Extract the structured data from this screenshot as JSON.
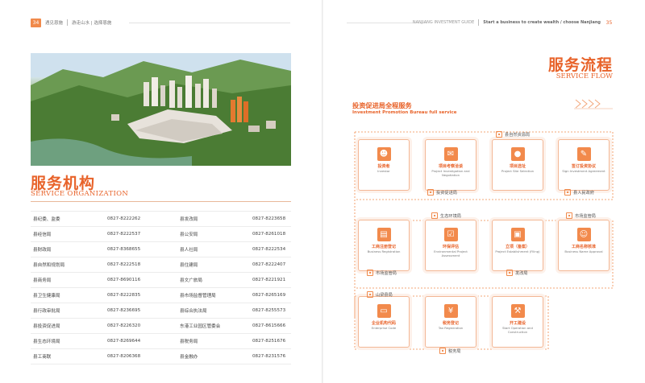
{
  "left_page": {
    "page_number": "34",
    "header_title": "遇见恩施",
    "header_subtitle": "游走山水 | 选择恩施",
    "title_cn": "服务机构",
    "title_en": "SERVICE ORGANIZATION",
    "directory": [
      [
        "县纪委、监委",
        "0827-8222262",
        "县发改局",
        "0827-8223658"
      ],
      [
        "县经信局",
        "0827-8222537",
        "县公安局",
        "0827-8261018"
      ],
      [
        "县财政局",
        "0827-8368655",
        "县人社局",
        "0827-8222534"
      ],
      [
        "县自然和规划局",
        "0827-8222518",
        "县住建局",
        "0827-8222407"
      ],
      [
        "县商务局",
        "0827-8690116",
        "县文广旅局",
        "0827-8221921"
      ],
      [
        "县卫生健康局",
        "0827-8222835",
        "县市场监督管理局",
        "0827-8265169"
      ],
      [
        "县行政审批局",
        "0827-8236695",
        "县综合执法局",
        "0827-8255573"
      ],
      [
        "县投资促进局",
        "0827-8226320",
        "东港工业园区管委会",
        "0827-8615666"
      ],
      [
        "县生态环境局",
        "0827-8269644",
        "县税务局",
        "0827-8251676"
      ],
      [
        "县工商联",
        "0827-8206368",
        "县金融办",
        "0827-8231576"
      ]
    ]
  },
  "right_page": {
    "page_number": "35",
    "header_en": "NANJIANG INVESTMENT GUIDE",
    "header_slogan": "Start a business to create wealth / choose Nanjiang",
    "title_cn": "服务流程",
    "title_en": "SERVICE FLOW",
    "subtitle_cn": "投资促进局全程服务",
    "subtitle_en": "Investment Promotion Bureau full service",
    "steps": [
      {
        "cn": "投资者",
        "en": "Investor",
        "icon": "person-icon"
      },
      {
        "cn": "项目考察洽谈",
        "en": "Project Investigation and Negotiation",
        "icon": "chat-icon"
      },
      {
        "cn": "项目选址",
        "en": "Project Site Selection",
        "icon": "location-pin-icon"
      },
      {
        "cn": "签订投资协议",
        "en": "Sign Investment Agreement",
        "icon": "contract-icon"
      },
      {
        "cn": "工商注册登记",
        "en": "Business Registration",
        "icon": "document-icon"
      },
      {
        "cn": "环保评估",
        "en": "Environmental Project Assessment",
        "icon": "checklist-icon"
      },
      {
        "cn": "立项（备案）",
        "en": "Project Establishment (Filing)",
        "icon": "stamp-icon"
      },
      {
        "cn": "工商名称核准",
        "en": "Business Name Approval",
        "icon": "id-card-icon"
      },
      {
        "cn": "企业机构代码",
        "en": "Enterprise Code",
        "icon": "code-icon"
      },
      {
        "cn": "税务登记",
        "en": "Tax Registration",
        "icon": "tax-icon"
      },
      {
        "cn": "开工建设",
        "en": "Start Operation and Construction",
        "icon": "construction-icon"
      }
    ],
    "agencies": {
      "planning": "县自然资源局",
      "investment": "投资促进局",
      "government": "县人民政府",
      "ecology": "生态环境局",
      "market_supervision": "市场监管局",
      "market_supervision_2": "市场监管局",
      "development": "发改局",
      "shared_services": "山梁县局",
      "tax": "税务局"
    }
  }
}
